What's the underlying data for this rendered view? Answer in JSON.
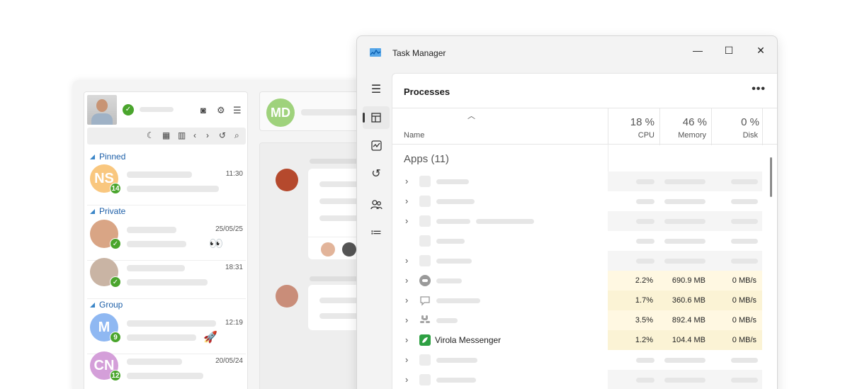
{
  "messenger": {
    "sections": {
      "pinned": "Pinned",
      "private": "Private",
      "group": "Group"
    },
    "chats": [
      {
        "initials": "NS",
        "time": "11:30",
        "badge": "14",
        "avatar_color": "#f9c77f"
      },
      {
        "initials": "",
        "time": "25/05/25",
        "badge": "✓",
        "emoji": "👀",
        "avatar_color": "#d9a585"
      },
      {
        "initials": "",
        "time": "18:31",
        "badge": "✓",
        "avatar_color": "#c9b4a4"
      },
      {
        "initials": "M",
        "time": "12:19",
        "badge": "9",
        "emoji": "🚀",
        "avatar_color": "#8fb8f2"
      },
      {
        "initials": "CN",
        "time": "20/05/24",
        "badge": "12",
        "avatar_color": "#d49fd9"
      }
    ],
    "conversation_initials": "MD"
  },
  "task_manager": {
    "title": "Task Manager",
    "panel_title": "Processes",
    "more_label": "•••",
    "window_controls": {
      "minimize": "—",
      "maximize": "☐",
      "close": "✕"
    },
    "columns": {
      "name": "Name",
      "cpu": {
        "pct": "18 %",
        "label": "CPU"
      },
      "memory": {
        "pct": "46 %",
        "label": "Memory"
      },
      "disk": {
        "pct": "0 %",
        "label": "Disk"
      }
    },
    "group_title": "Apps (11)",
    "rows": [
      {
        "expand": true,
        "name": "",
        "cpu": "",
        "memory": "",
        "disk": ""
      },
      {
        "expand": true,
        "name": "",
        "cpu": "",
        "memory": "",
        "disk": ""
      },
      {
        "expand": true,
        "name": "",
        "cpu": "",
        "memory": "",
        "disk": ""
      },
      {
        "expand": false,
        "name": "",
        "cpu": "",
        "memory": "",
        "disk": ""
      },
      {
        "expand": true,
        "name": "",
        "cpu": "",
        "memory": "",
        "disk": ""
      },
      {
        "expand": true,
        "name": "",
        "icon": "discord-icon",
        "cpu": "2.2%",
        "memory": "690.9 MB",
        "disk": "0 MB/s"
      },
      {
        "expand": true,
        "name": "",
        "icon": "chat-bubble-icon",
        "cpu": "1.7%",
        "memory": "360.6 MB",
        "disk": "0 MB/s"
      },
      {
        "expand": true,
        "name": "",
        "icon": "slack-icon",
        "cpu": "3.5%",
        "memory": "892.4 MB",
        "disk": "0 MB/s"
      },
      {
        "expand": true,
        "name": "Virola Messenger",
        "icon": "virola-icon",
        "cpu": "1.2%",
        "memory": "104.4 MB",
        "disk": "0 MB/s"
      },
      {
        "expand": true,
        "name": "",
        "cpu": "",
        "memory": "",
        "disk": ""
      },
      {
        "expand": true,
        "name": "",
        "cpu": "",
        "memory": "",
        "disk": ""
      }
    ],
    "colors": {
      "virola_green": "#2ea043",
      "accent": "#3a3a3a"
    }
  }
}
